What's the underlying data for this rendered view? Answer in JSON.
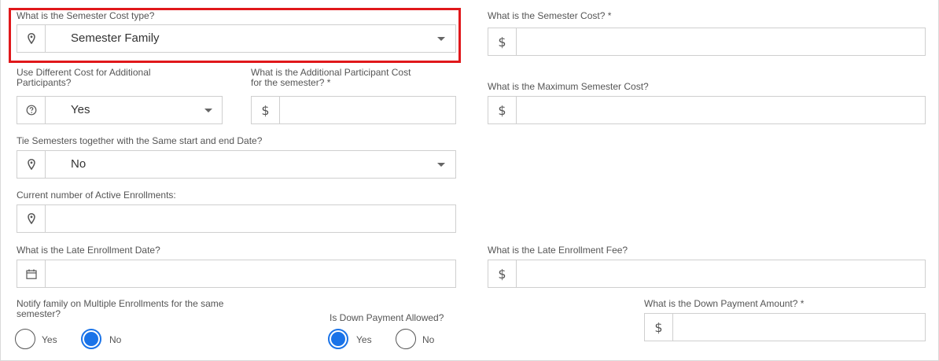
{
  "cost_type": {
    "label": "What is the Semester Cost type?",
    "value": "Semester Family",
    "icon": "map-marker-icon"
  },
  "semester_cost": {
    "label": "What is the Semester Cost? *",
    "prefix": "$",
    "value": ""
  },
  "different_cost": {
    "label_line1": "Use Different Cost for Additional",
    "label_line2": "Participants?",
    "value": "Yes",
    "icon": "question-circle-icon"
  },
  "additional_cost": {
    "label_line1": "What is the Additional Participant Cost",
    "label_line2": "for the semester? *",
    "prefix": "$",
    "value": ""
  },
  "max_cost": {
    "label": "What is the Maximum Semester Cost?",
    "prefix": "$",
    "value": ""
  },
  "tie_semesters": {
    "label": "Tie Semesters together with the Same start and end Date?",
    "value": "No",
    "icon": "map-marker-icon"
  },
  "active_enrollments": {
    "label": "Current number of Active Enrollments:",
    "value": "",
    "icon": "map-marker-icon"
  },
  "late_date": {
    "label": "What is the Late Enrollment Date?",
    "value": "",
    "icon": "calendar-icon"
  },
  "late_fee": {
    "label": "What is the Late Enrollment Fee?",
    "prefix": "$",
    "value": ""
  },
  "notify_family": {
    "label_line1": "Notify family on Multiple Enrollments for the same",
    "label_line2": "semester?",
    "options": [
      "Yes",
      "No"
    ],
    "selected": "No"
  },
  "down_payment_allowed": {
    "label": "Is Down Payment Allowed?",
    "options": [
      "Yes",
      "No"
    ],
    "selected": "Yes"
  },
  "down_payment_amount": {
    "label": "What is the Down Payment Amount? *",
    "prefix": "$",
    "value": ""
  },
  "colors": {
    "highlight": "#e0181b",
    "radio_selected": "#1a73e8",
    "border": "#cfcfcf"
  }
}
